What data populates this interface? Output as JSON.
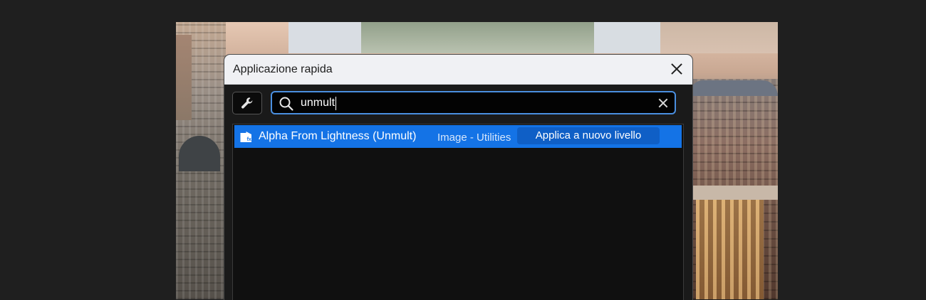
{
  "dialog": {
    "title": "Applicazione rapida"
  },
  "search": {
    "value": "unmult",
    "tool_icon": "wrench-icon",
    "search_icon": "search-icon",
    "clear_icon": "clear-icon"
  },
  "results": [
    {
      "name": "Alpha From Lightness (Unmult)",
      "category": "Image - Utilities",
      "action": "Applica a nuovo livello",
      "icon": "effect-icon",
      "selected": true
    }
  ],
  "colors": {
    "accent": "#1473e6",
    "search_border": "#4a8fe0",
    "titlebar": "#f0f1f4",
    "background": "#1f1f1f"
  }
}
